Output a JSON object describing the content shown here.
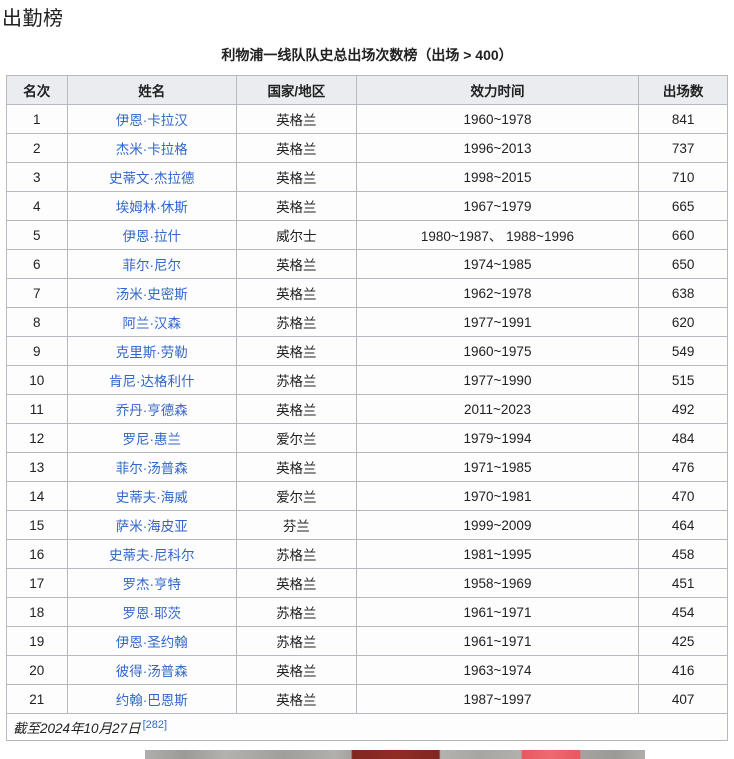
{
  "heading": "出勤榜",
  "table": {
    "caption": "利物浦一线队队史总出场次数榜（出场 > 400）",
    "columns": [
      "名次",
      "姓名",
      "国家/地区",
      "效力时间",
      "出场数"
    ],
    "rows": [
      {
        "rank": "1",
        "name": "伊恩·卡拉汉",
        "country": "英格兰",
        "period": "1960~1978",
        "apps": "841"
      },
      {
        "rank": "2",
        "name": "杰米·卡拉格",
        "country": "英格兰",
        "period": "1996~2013",
        "apps": "737"
      },
      {
        "rank": "3",
        "name": "史蒂文·杰拉德",
        "country": "英格兰",
        "period": "1998~2015",
        "apps": "710"
      },
      {
        "rank": "4",
        "name": "埃姆林·休斯",
        "country": "英格兰",
        "period": "1967~1979",
        "apps": "665"
      },
      {
        "rank": "5",
        "name": "伊恩·拉什",
        "country": "威尔士",
        "period": "1980~1987、 1988~1996",
        "apps": "660"
      },
      {
        "rank": "6",
        "name": "菲尔·尼尔",
        "country": "英格兰",
        "period": "1974~1985",
        "apps": "650"
      },
      {
        "rank": "7",
        "name": "汤米·史密斯",
        "country": "英格兰",
        "period": "1962~1978",
        "apps": "638"
      },
      {
        "rank": "8",
        "name": "阿兰·汉森",
        "country": "苏格兰",
        "period": "1977~1991",
        "apps": "620"
      },
      {
        "rank": "9",
        "name": "克里斯·劳勒",
        "country": "英格兰",
        "period": "1960~1975",
        "apps": "549"
      },
      {
        "rank": "10",
        "name": "肯尼·达格利什",
        "country": "苏格兰",
        "period": "1977~1990",
        "apps": "515"
      },
      {
        "rank": "11",
        "name": "乔丹·亨德森",
        "country": "英格兰",
        "period": "2011~2023",
        "apps": "492"
      },
      {
        "rank": "12",
        "name": "罗尼·惠兰",
        "country": "爱尔兰",
        "period": "1979~1994",
        "apps": "484"
      },
      {
        "rank": "13",
        "name": "菲尔·汤普森",
        "country": "英格兰",
        "period": "1971~1985",
        "apps": "476"
      },
      {
        "rank": "14",
        "name": "史蒂夫·海威",
        "country": "爱尔兰",
        "period": "1970~1981",
        "apps": "470"
      },
      {
        "rank": "15",
        "name": "萨米·海皮亚",
        "country": "芬兰",
        "period": "1999~2009",
        "apps": "464"
      },
      {
        "rank": "16",
        "name": "史蒂夫·尼科尔",
        "country": "苏格兰",
        "period": "1981~1995",
        "apps": "458"
      },
      {
        "rank": "17",
        "name": "罗杰·亨特",
        "country": "英格兰",
        "period": "1958~1969",
        "apps": "451"
      },
      {
        "rank": "18",
        "name": "罗恩·耶茨",
        "country": "苏格兰",
        "period": "1961~1971",
        "apps": "454"
      },
      {
        "rank": "19",
        "name": "伊恩·圣约翰",
        "country": "苏格兰",
        "period": "1961~1971",
        "apps": "425"
      },
      {
        "rank": "20",
        "name": "彼得·汤普森",
        "country": "英格兰",
        "period": "1963~1974",
        "apps": "416"
      },
      {
        "rank": "21",
        "name": "约翰·巴恩斯",
        "country": "英格兰",
        "period": "1987~1997",
        "apps": "407"
      }
    ],
    "footnote_text": "截至2024年10月27日",
    "footnote_ref": "[282]"
  },
  "colors": {
    "link": "#3366cc",
    "text": "#202122",
    "border": "#b5bac1",
    "header_bg": "#eaecf0",
    "strip_dark_red": "#812620",
    "strip_pink": "#e9575e"
  }
}
